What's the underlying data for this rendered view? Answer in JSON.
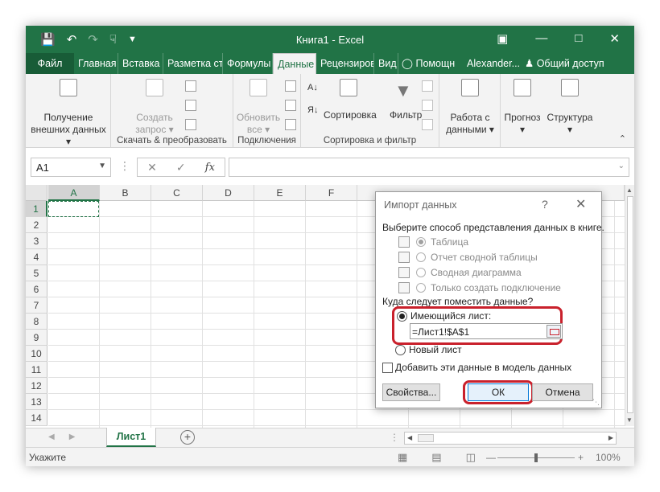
{
  "window": {
    "title": "Книга1 - Excel"
  },
  "qat": {
    "save_icon": "save-icon",
    "undo_icon": "undo-icon",
    "redo_icon": "redo-icon",
    "touch_icon": "touch-mode-icon"
  },
  "tabs": [
    {
      "label": "Файл"
    },
    {
      "label": "Главная"
    },
    {
      "label": "Вставка"
    },
    {
      "label": "Разметка ст"
    },
    {
      "label": "Формулы"
    },
    {
      "label": "Данные"
    },
    {
      "label": "Рецензиров"
    },
    {
      "label": "Вид"
    },
    {
      "label": "Помощн"
    },
    {
      "label": "Alexander..."
    },
    {
      "label": "Общий доступ"
    }
  ],
  "ribbon": {
    "get_external": {
      "line1": "Получение",
      "line2": "внешних данных"
    },
    "create_query": {
      "line1": "Создать",
      "line2": "запрос"
    },
    "group_transform": "Скачать & преобразовать",
    "refresh_all": {
      "line1": "Обновить",
      "line2": "все"
    },
    "group_connections": "Подключения",
    "sort": "Сортировка",
    "filter": "Фильтр",
    "group_sortfilter": "Сортировка и фильтр",
    "data_tools": {
      "line1": "Работа с",
      "line2": "данными"
    },
    "forecast": "Прогноз",
    "outline": "Структура"
  },
  "formula_bar": {
    "name_box": "A1",
    "fx": "fx",
    "value": ""
  },
  "grid": {
    "columns": [
      "A",
      "B",
      "C",
      "D",
      "E",
      "F"
    ],
    "rows": [
      "1",
      "2",
      "3",
      "4",
      "5",
      "6",
      "7",
      "8",
      "9",
      "10",
      "11",
      "12",
      "13",
      "14"
    ]
  },
  "sheets": {
    "active": "Лист1",
    "add": "+"
  },
  "status": {
    "mode": "Укажите",
    "zoom": "100%"
  },
  "dialog": {
    "title": "Импорт данных",
    "help": "?",
    "prompt": "Выберите способ представления данных в книге.",
    "options": [
      {
        "label": "Таблица",
        "checked": true
      },
      {
        "label": "Отчет сводной таблицы",
        "checked": false
      },
      {
        "label": "Сводная диаграмма",
        "checked": false
      },
      {
        "label": "Только создать подключение",
        "checked": false
      }
    ],
    "where_prompt": "Куда следует поместить данные?",
    "existing_sheet": "Имеющийся лист:",
    "reference": "=Лист1!$A$1",
    "new_sheet": "Новый лист",
    "add_to_model": "Добавить эти данные в модель данных",
    "properties": "Свойства...",
    "ok": "ОК",
    "cancel": "Отмена"
  },
  "colors": {
    "excel_green": "#217346",
    "highlight_red": "#c9212c"
  }
}
